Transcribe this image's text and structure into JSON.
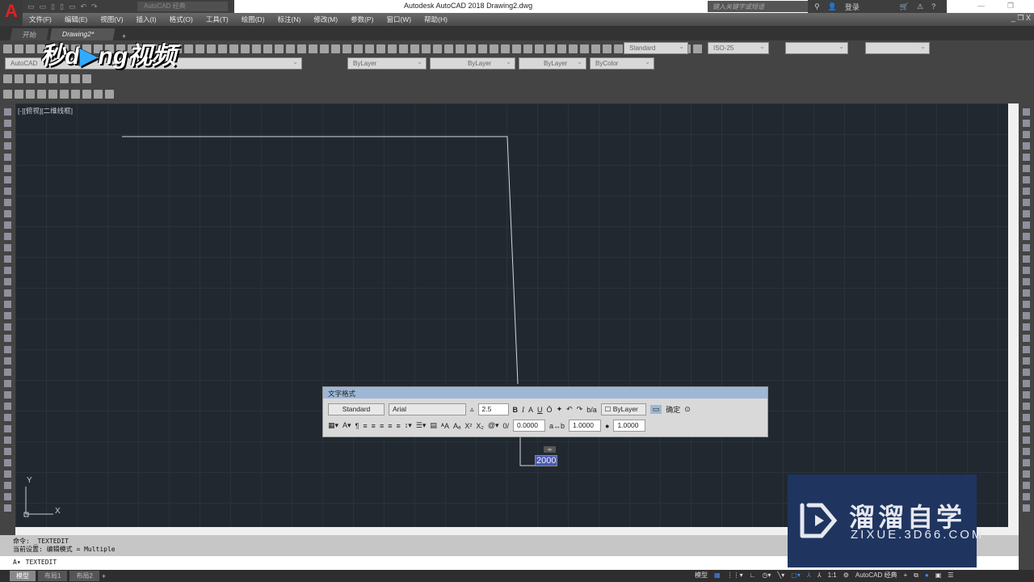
{
  "app": {
    "title": "Autodesk AutoCAD 2018    Drawing2.dwg",
    "logo": "A",
    "workspace": "AutoCAD 经典",
    "search_placeholder": "键入关键字或短语",
    "login": "登录"
  },
  "menu": [
    "文件(F)",
    "编辑(E)",
    "视图(V)",
    "插入(I)",
    "格式(O)",
    "工具(T)",
    "绘图(D)",
    "标注(N)",
    "修改(M)",
    "参数(P)",
    "窗口(W)",
    "帮助(H)"
  ],
  "file_tabs": [
    {
      "label": "开始"
    },
    {
      "label": "Drawing2*",
      "active": true
    }
  ],
  "toolbar": {
    "workspace_select": "AutoCAD",
    "text_style": "Standard",
    "dim_style": "ISO-25",
    "layer_color": "ByLayer",
    "linetype": "ByLayer",
    "lineweight": "ByLayer",
    "plot_style": "ByColor"
  },
  "viewport": {
    "label": "[-][俯视][二维线框]",
    "ucs_x": "X",
    "ucs_y": "Y"
  },
  "text_editor": {
    "title": "文字格式",
    "style": "Standard",
    "font": "Arial",
    "height": "2.5",
    "color": "ByLayer",
    "ok": "确定",
    "oblique": "0.0000",
    "tracking": "1.0000",
    "width_factor": "1.0000",
    "content": "2000"
  },
  "command": {
    "history": [
      "命令:  _TEXTEDIT",
      "当前设置: 编辑模式 = Multiple"
    ],
    "current": "TEXTEDIT"
  },
  "layout_tabs": [
    "模型",
    "布局1",
    "布局2"
  ],
  "status": {
    "model": "模型",
    "scale": "1:1",
    "workspace": "AutoCAD 经典"
  },
  "watermarks": {
    "top": "秒dong视频",
    "box_title": "溜溜自学",
    "box_url": "ZIXUE.3D66.COM"
  },
  "colors": {
    "canvas": "#212830",
    "editor_title": "#9db7d5",
    "selection": "#4a5bb0",
    "watermark_box": "#1f3560"
  }
}
